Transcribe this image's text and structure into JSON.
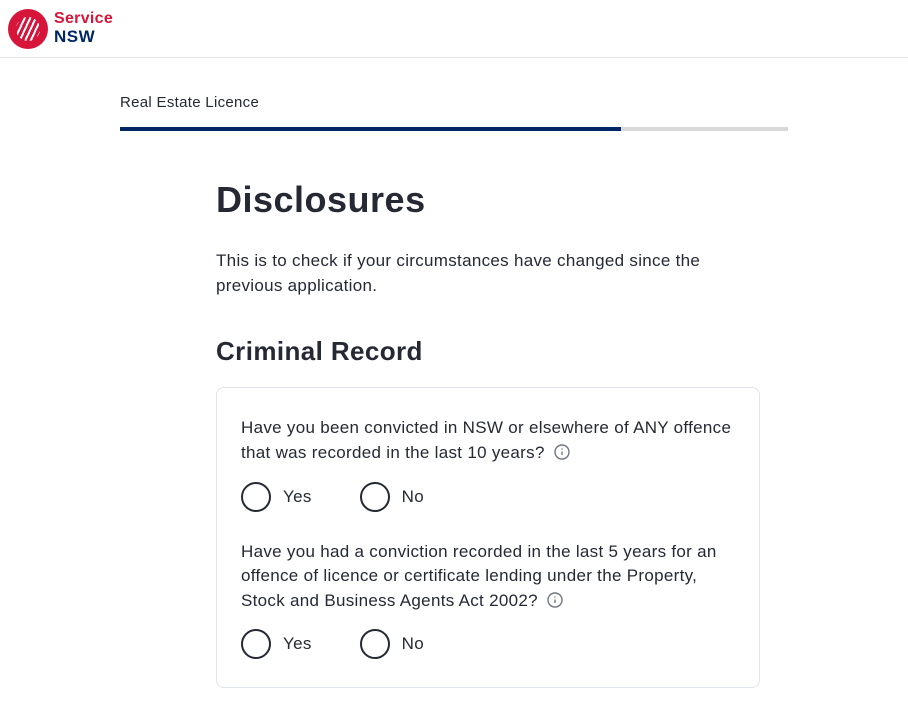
{
  "header": {
    "logo_top": "Service",
    "logo_bottom": "NSW"
  },
  "breadcrumb": "Real Estate Licence",
  "progress_percent": 75,
  "page": {
    "title": "Disclosures",
    "intro": "This is to check if your circumstances have changed since the previous application."
  },
  "section": {
    "title": "Criminal Record",
    "questions": [
      {
        "text": "Have you been convicted in NSW or elsewhere of ANY offence that was recorded in the last 10 years?",
        "yes": "Yes",
        "no": "No"
      },
      {
        "text": "Have you had a conviction recorded in the last 5 years for an offence of licence or certificate lending under the Property, Stock and Business Agents Act 2002?",
        "yes": "Yes",
        "no": "No"
      }
    ]
  }
}
